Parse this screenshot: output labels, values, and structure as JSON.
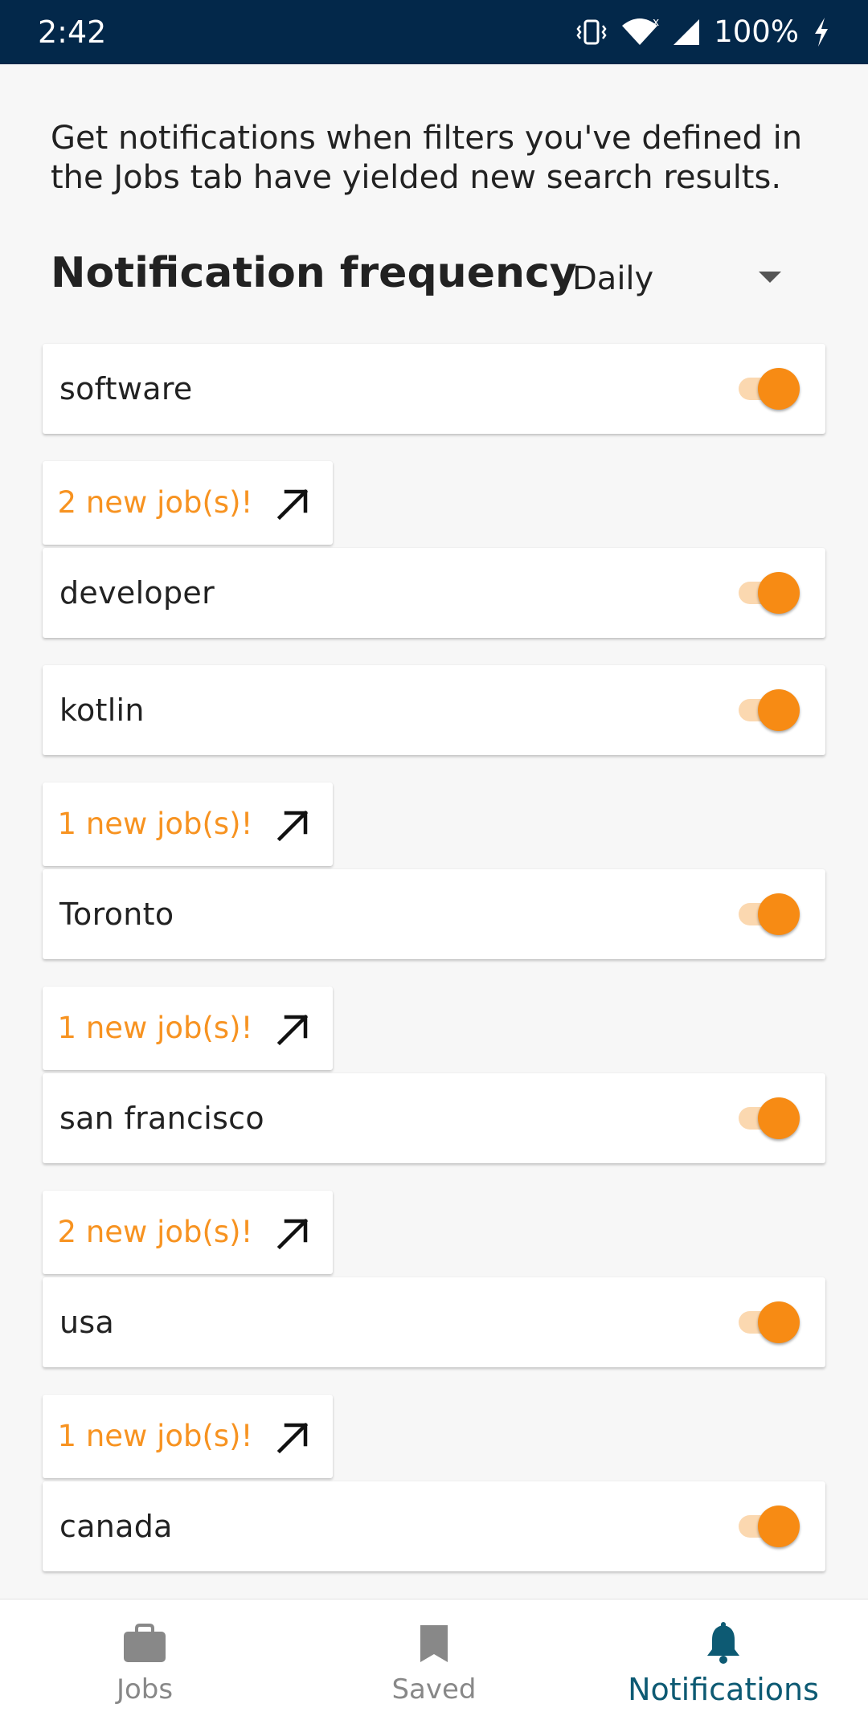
{
  "status_bar": {
    "time": "2:42",
    "battery": "100%",
    "icons": [
      "vibrate-icon",
      "wifi-icon",
      "signal-icon",
      "charging-icon"
    ],
    "background_color": "#03284a"
  },
  "intro": {
    "text": "Get notifications when filters you've defined in the Jobs tab have yielded new search results."
  },
  "frequency": {
    "title": "Notification frequency",
    "selected": "Daily"
  },
  "accent_color": "#f78b14",
  "filters": [
    {
      "label": "software",
      "enabled": true,
      "new_jobs": "2 new job(s)!"
    },
    {
      "label": "developer",
      "enabled": true,
      "new_jobs": null
    },
    {
      "label": "kotlin",
      "enabled": true,
      "new_jobs": "1 new job(s)!"
    },
    {
      "label": "Toronto",
      "enabled": true,
      "new_jobs": "1 new job(s)!"
    },
    {
      "label": "san francisco",
      "enabled": true,
      "new_jobs": "2 new job(s)!"
    },
    {
      "label": "usa",
      "enabled": true,
      "new_jobs": "1 new job(s)!"
    },
    {
      "label": "canada",
      "enabled": true,
      "new_jobs": null
    }
  ],
  "bottom_nav": {
    "items": [
      {
        "label": "Jobs",
        "icon": "briefcase-icon",
        "active": false
      },
      {
        "label": "Saved",
        "icon": "bookmark-icon",
        "active": false
      },
      {
        "label": "Notifications",
        "icon": "bell-icon",
        "active": true
      }
    ],
    "active_color": "#0d5a73"
  }
}
